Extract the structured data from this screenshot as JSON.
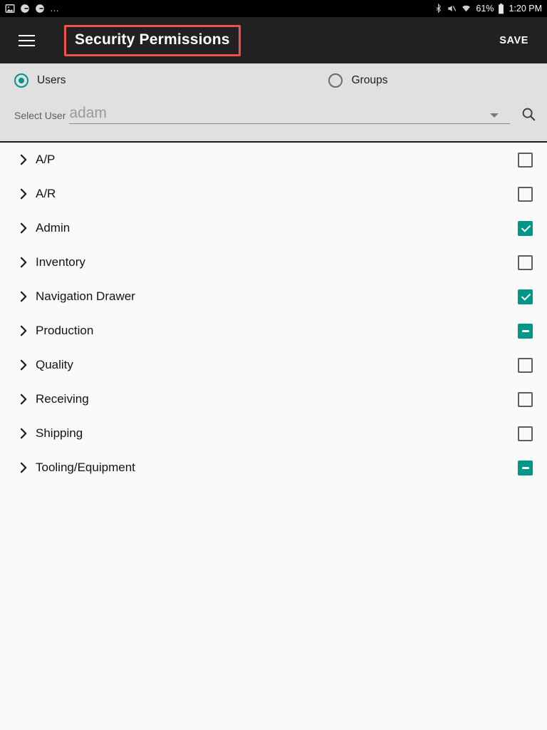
{
  "statusbar": {
    "left_icons": [
      "image-icon",
      "notification-icon",
      "notification-icon"
    ],
    "overflow": "…",
    "bluetooth_icon": "bluetooth-icon",
    "mute_icon": "volume-mute-icon",
    "wifi_icon": "wifi-icon",
    "battery_percent": "61%",
    "battery_icon": "battery-icon",
    "time": "1:20 PM"
  },
  "appbar": {
    "menu_icon": "hamburger-menu-icon",
    "title": "Security Permissions",
    "save_label": "SAVE",
    "highlight_color": "#f4504a"
  },
  "selector": {
    "radios": [
      {
        "label": "Users",
        "selected": true
      },
      {
        "label": "Groups",
        "selected": false
      }
    ],
    "field_label": "Select User",
    "field_value": "adam",
    "dropdown_icon": "chevron-down-icon",
    "search_icon": "search-icon",
    "accent_color": "#009688"
  },
  "permissions": {
    "rows": [
      {
        "label": "A/P",
        "state": "unchecked",
        "expand_icon": "chevron-right-icon"
      },
      {
        "label": "A/R",
        "state": "unchecked",
        "expand_icon": "chevron-right-icon"
      },
      {
        "label": "Admin",
        "state": "checked",
        "expand_icon": "chevron-right-icon"
      },
      {
        "label": "Inventory",
        "state": "unchecked",
        "expand_icon": "chevron-right-icon"
      },
      {
        "label": "Navigation Drawer",
        "state": "checked",
        "expand_icon": "chevron-right-icon"
      },
      {
        "label": "Production",
        "state": "indeterminate",
        "expand_icon": "chevron-right-icon"
      },
      {
        "label": "Quality",
        "state": "unchecked",
        "expand_icon": "chevron-right-icon"
      },
      {
        "label": "Receiving",
        "state": "unchecked",
        "expand_icon": "chevron-right-icon"
      },
      {
        "label": "Shipping",
        "state": "unchecked",
        "expand_icon": "chevron-right-icon"
      },
      {
        "label": "Tooling/Equipment",
        "state": "indeterminate",
        "expand_icon": "chevron-right-icon"
      }
    ]
  }
}
